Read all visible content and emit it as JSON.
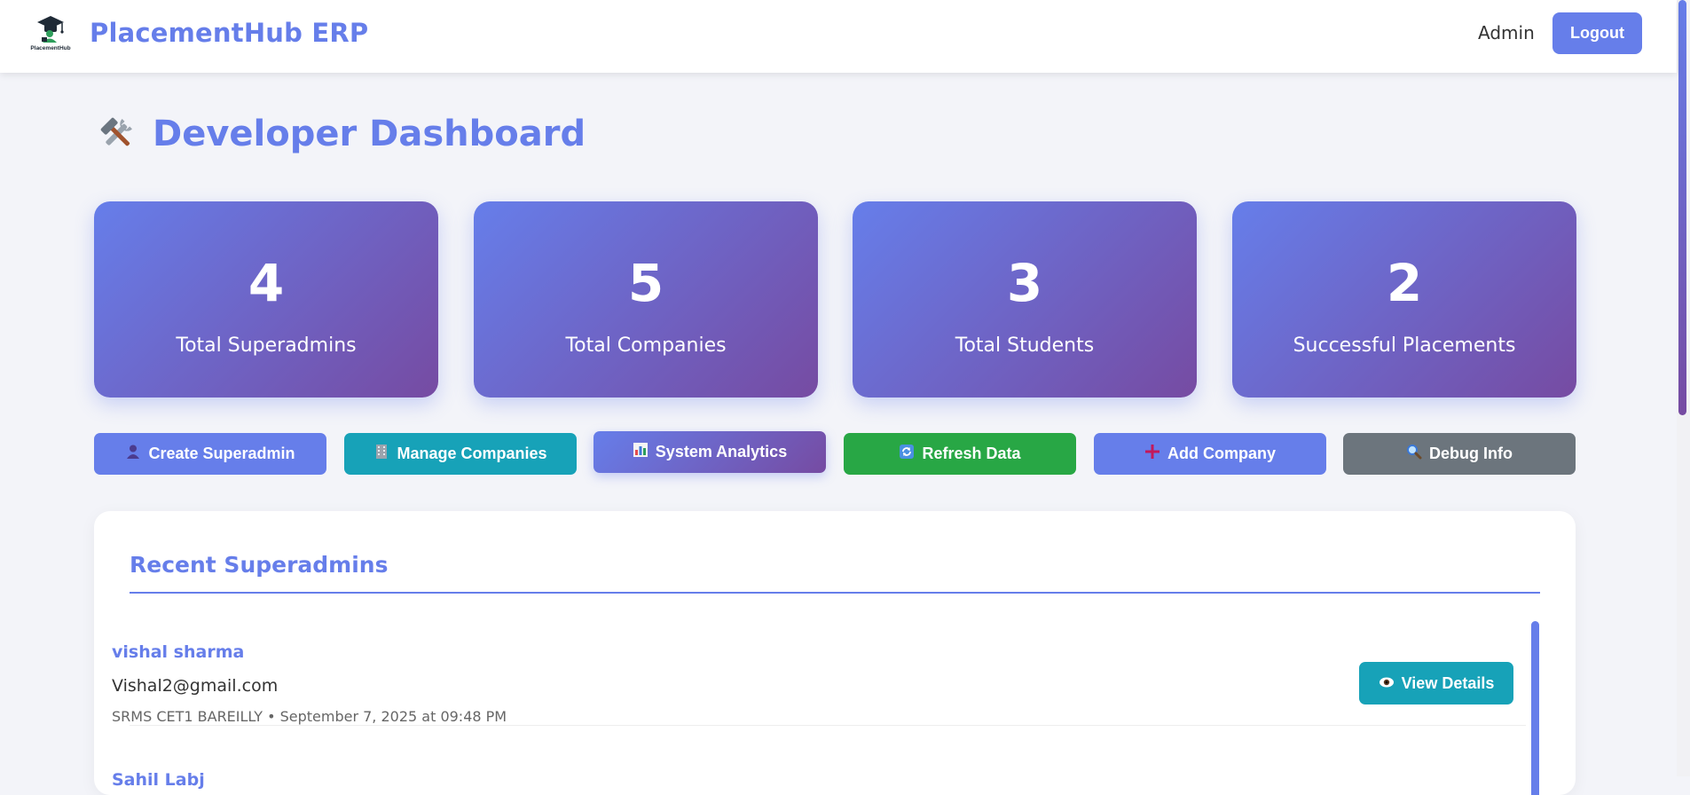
{
  "header": {
    "brand": "PlacementHub ERP",
    "logo_text": "PlacementHub",
    "user_label": "Admin",
    "logout_label": "Logout"
  },
  "page": {
    "title": "Developer Dashboard",
    "title_icon": "hammer-wrench-icon"
  },
  "stats": [
    {
      "value": "4",
      "label": "Total Superadmins"
    },
    {
      "value": "5",
      "label": "Total Companies"
    },
    {
      "value": "3",
      "label": "Total Students"
    },
    {
      "value": "2",
      "label": "Successful Placements"
    }
  ],
  "actions": [
    {
      "label": "Create Superadmin",
      "icon": "user-icon",
      "color": "#667eea"
    },
    {
      "label": "Manage Companies",
      "icon": "building-icon",
      "color": "#17a2b8"
    },
    {
      "label": "System Analytics",
      "icon": "bar-chart-icon",
      "color": "#667eea"
    },
    {
      "label": "Refresh Data",
      "icon": "refresh-icon",
      "color": "#28a745"
    },
    {
      "label": "Add Company",
      "icon": "plus-icon",
      "color": "#667eea"
    },
    {
      "label": "Debug Info",
      "icon": "magnifier-icon",
      "color": "#6c757d"
    }
  ],
  "recent": {
    "title": "Recent Superadmins",
    "items": [
      {
        "name": "vishal sharma",
        "email": "Vishal2@gmail.com",
        "meta": "SRMS CET1 BAREILLY • September 7, 2025 at 09:48 PM",
        "button_label": "View Details"
      },
      {
        "name": "Sahil Labj"
      }
    ]
  },
  "colors": {
    "accent": "#667eea",
    "accent_dark": "#764ba2",
    "teal": "#17a2b8",
    "green": "#28a745",
    "gray": "#6c757d"
  }
}
